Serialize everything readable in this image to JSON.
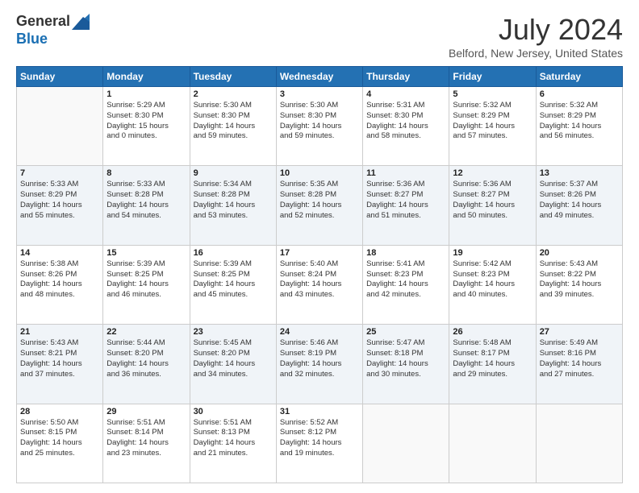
{
  "header": {
    "logo_line1": "General",
    "logo_line2": "Blue",
    "month": "July 2024",
    "location": "Belford, New Jersey, United States"
  },
  "weekdays": [
    "Sunday",
    "Monday",
    "Tuesday",
    "Wednesday",
    "Thursday",
    "Friday",
    "Saturday"
  ],
  "weeks": [
    [
      {
        "day": "",
        "info": ""
      },
      {
        "day": "1",
        "info": "Sunrise: 5:29 AM\nSunset: 8:30 PM\nDaylight: 15 hours\nand 0 minutes."
      },
      {
        "day": "2",
        "info": "Sunrise: 5:30 AM\nSunset: 8:30 PM\nDaylight: 14 hours\nand 59 minutes."
      },
      {
        "day": "3",
        "info": "Sunrise: 5:30 AM\nSunset: 8:30 PM\nDaylight: 14 hours\nand 59 minutes."
      },
      {
        "day": "4",
        "info": "Sunrise: 5:31 AM\nSunset: 8:30 PM\nDaylight: 14 hours\nand 58 minutes."
      },
      {
        "day": "5",
        "info": "Sunrise: 5:32 AM\nSunset: 8:29 PM\nDaylight: 14 hours\nand 57 minutes."
      },
      {
        "day": "6",
        "info": "Sunrise: 5:32 AM\nSunset: 8:29 PM\nDaylight: 14 hours\nand 56 minutes."
      }
    ],
    [
      {
        "day": "7",
        "info": "Sunrise: 5:33 AM\nSunset: 8:29 PM\nDaylight: 14 hours\nand 55 minutes."
      },
      {
        "day": "8",
        "info": "Sunrise: 5:33 AM\nSunset: 8:28 PM\nDaylight: 14 hours\nand 54 minutes."
      },
      {
        "day": "9",
        "info": "Sunrise: 5:34 AM\nSunset: 8:28 PM\nDaylight: 14 hours\nand 53 minutes."
      },
      {
        "day": "10",
        "info": "Sunrise: 5:35 AM\nSunset: 8:28 PM\nDaylight: 14 hours\nand 52 minutes."
      },
      {
        "day": "11",
        "info": "Sunrise: 5:36 AM\nSunset: 8:27 PM\nDaylight: 14 hours\nand 51 minutes."
      },
      {
        "day": "12",
        "info": "Sunrise: 5:36 AM\nSunset: 8:27 PM\nDaylight: 14 hours\nand 50 minutes."
      },
      {
        "day": "13",
        "info": "Sunrise: 5:37 AM\nSunset: 8:26 PM\nDaylight: 14 hours\nand 49 minutes."
      }
    ],
    [
      {
        "day": "14",
        "info": "Sunrise: 5:38 AM\nSunset: 8:26 PM\nDaylight: 14 hours\nand 48 minutes."
      },
      {
        "day": "15",
        "info": "Sunrise: 5:39 AM\nSunset: 8:25 PM\nDaylight: 14 hours\nand 46 minutes."
      },
      {
        "day": "16",
        "info": "Sunrise: 5:39 AM\nSunset: 8:25 PM\nDaylight: 14 hours\nand 45 minutes."
      },
      {
        "day": "17",
        "info": "Sunrise: 5:40 AM\nSunset: 8:24 PM\nDaylight: 14 hours\nand 43 minutes."
      },
      {
        "day": "18",
        "info": "Sunrise: 5:41 AM\nSunset: 8:23 PM\nDaylight: 14 hours\nand 42 minutes."
      },
      {
        "day": "19",
        "info": "Sunrise: 5:42 AM\nSunset: 8:23 PM\nDaylight: 14 hours\nand 40 minutes."
      },
      {
        "day": "20",
        "info": "Sunrise: 5:43 AM\nSunset: 8:22 PM\nDaylight: 14 hours\nand 39 minutes."
      }
    ],
    [
      {
        "day": "21",
        "info": "Sunrise: 5:43 AM\nSunset: 8:21 PM\nDaylight: 14 hours\nand 37 minutes."
      },
      {
        "day": "22",
        "info": "Sunrise: 5:44 AM\nSunset: 8:20 PM\nDaylight: 14 hours\nand 36 minutes."
      },
      {
        "day": "23",
        "info": "Sunrise: 5:45 AM\nSunset: 8:20 PM\nDaylight: 14 hours\nand 34 minutes."
      },
      {
        "day": "24",
        "info": "Sunrise: 5:46 AM\nSunset: 8:19 PM\nDaylight: 14 hours\nand 32 minutes."
      },
      {
        "day": "25",
        "info": "Sunrise: 5:47 AM\nSunset: 8:18 PM\nDaylight: 14 hours\nand 30 minutes."
      },
      {
        "day": "26",
        "info": "Sunrise: 5:48 AM\nSunset: 8:17 PM\nDaylight: 14 hours\nand 29 minutes."
      },
      {
        "day": "27",
        "info": "Sunrise: 5:49 AM\nSunset: 8:16 PM\nDaylight: 14 hours\nand 27 minutes."
      }
    ],
    [
      {
        "day": "28",
        "info": "Sunrise: 5:50 AM\nSunset: 8:15 PM\nDaylight: 14 hours\nand 25 minutes."
      },
      {
        "day": "29",
        "info": "Sunrise: 5:51 AM\nSunset: 8:14 PM\nDaylight: 14 hours\nand 23 minutes."
      },
      {
        "day": "30",
        "info": "Sunrise: 5:51 AM\nSunset: 8:13 PM\nDaylight: 14 hours\nand 21 minutes."
      },
      {
        "day": "31",
        "info": "Sunrise: 5:52 AM\nSunset: 8:12 PM\nDaylight: 14 hours\nand 19 minutes."
      },
      {
        "day": "",
        "info": ""
      },
      {
        "day": "",
        "info": ""
      },
      {
        "day": "",
        "info": ""
      }
    ]
  ]
}
